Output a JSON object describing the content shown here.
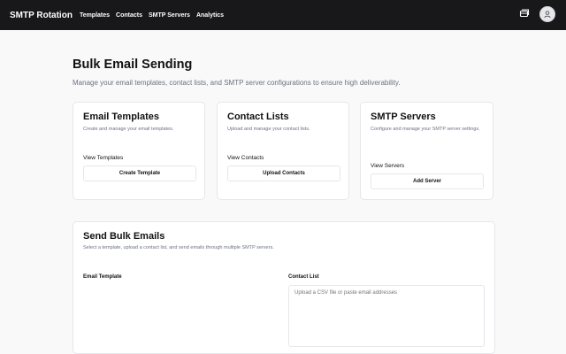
{
  "app": {
    "brand": "SMTP Rotation",
    "nav": [
      "Templates",
      "Contacts",
      "SMTP Servers",
      "Analytics"
    ]
  },
  "page": {
    "title": "Bulk Email Sending",
    "description": "Manage your email templates, contact lists, and SMTP server configurations to ensure high deliverability."
  },
  "cards": [
    {
      "title": "Email Templates",
      "description": "Create and manage your email templates.",
      "link": "View Templates",
      "button": "Create Template"
    },
    {
      "title": "Contact Lists",
      "description": "Upload and manage your contact lists.",
      "link": "View Contacts",
      "button": "Upload Contacts"
    },
    {
      "title": "SMTP Servers",
      "description": "Configure and manage your SMTP server settings.",
      "link": "View Servers",
      "button": "Add Server"
    }
  ],
  "bulk": {
    "title": "Send Bulk Emails",
    "description": "Select a template, upload a contact list, and send emails through multiple SMTP servers.",
    "template_label": "Email Template",
    "contact_label": "Contact List",
    "contact_placeholder": "Upload a CSV file or paste email addresses"
  },
  "icons": {
    "messages": "messages-icon",
    "user": "user-avatar-icon"
  },
  "colors": {
    "topbar": "#18181b",
    "background": "#f9f9f9",
    "muted_text": "#6b7280",
    "border": "#e5e7eb"
  }
}
